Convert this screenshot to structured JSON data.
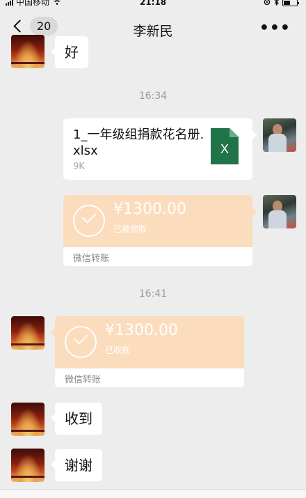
{
  "status_bar": {
    "carrier": "中国移动",
    "wifi_icon": "wifi-icon",
    "time": "21:18",
    "battery_icon": "battery-icon"
  },
  "nav": {
    "back_icon": "chevron-left-icon",
    "unread_count": "20",
    "title": "李新民",
    "more_icon": "more-dots-icon",
    "more_label": "•••"
  },
  "messages": {
    "m1_text": "好",
    "divider_1": "16:34",
    "file": {
      "name": "1_一年级组捐款花名册.xlsx",
      "size": "9K",
      "icon_letter": "X",
      "icon": "excel-file-icon",
      "icon_color": "#21734a"
    },
    "transfer_1": {
      "amount": "¥1300.00",
      "status": "已被领取",
      "footer": "微信转账",
      "icon": "checkmark-circle-icon",
      "color": "#fbdcbd"
    },
    "divider_2": "16:41",
    "transfer_2": {
      "amount": "¥1300.00",
      "status": "已收款",
      "footer": "微信转账",
      "icon": "checkmark-circle-icon",
      "color": "#fbdcbd"
    },
    "m2_text": "收到",
    "m3_text": "谢谢"
  }
}
